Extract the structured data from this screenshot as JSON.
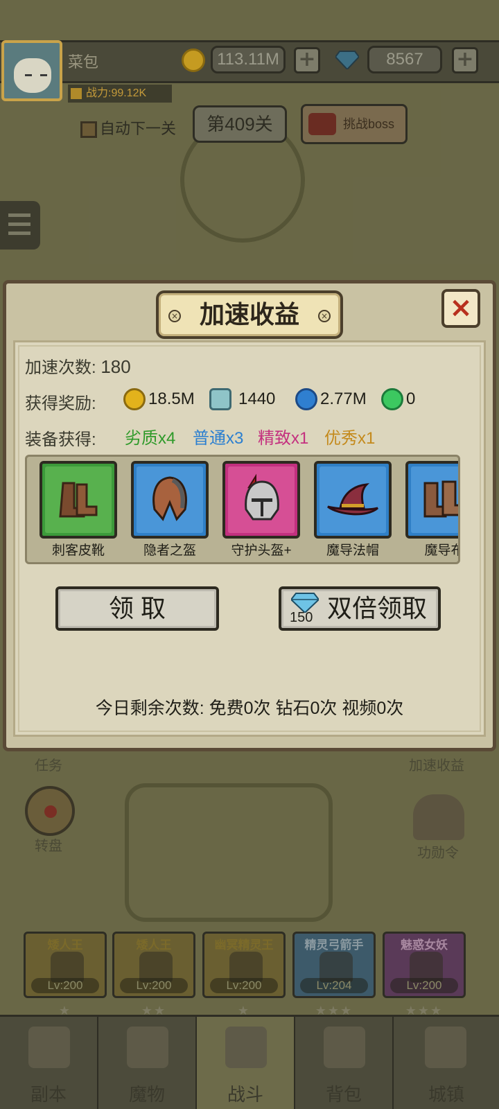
{
  "player": {
    "name": "菜包",
    "power": "战力:99.12K"
  },
  "resources": {
    "gold": "113.11M",
    "diamonds": "8567",
    "plus": "+"
  },
  "stage": {
    "auto_next_label": "自动下一关",
    "current_stage": "第409关",
    "boss_button": "挑战boss"
  },
  "background_labels": {
    "task": "任务",
    "speedup": "加速收益",
    "wheel": "转盘",
    "merit": "功勋令"
  },
  "heroes": [
    {
      "name": "矮人王",
      "level": "Lv:200",
      "stars": "★"
    },
    {
      "name": "矮人王",
      "level": "Lv:200",
      "stars": "★★"
    },
    {
      "name": "幽冥精灵王",
      "level": "Lv:200",
      "stars": "★"
    },
    {
      "name": "精灵弓箭手",
      "level": "Lv:204",
      "stars": "★★★"
    },
    {
      "name": "魅惑女妖",
      "level": "Lv:200",
      "stars": "★★★"
    }
  ],
  "bottom_nav": [
    {
      "label": "副本"
    },
    {
      "label": "魔物"
    },
    {
      "label": "战斗"
    },
    {
      "label": "背包"
    },
    {
      "label": "城镇"
    }
  ],
  "modal": {
    "title": "加速收益",
    "close": "×",
    "speedup_count_label": "加速次数:",
    "speedup_count_value": "180",
    "rewards_label": "获得奖励:",
    "rewards": [
      {
        "icon": "gold-coin-icon",
        "value": "18.5M"
      },
      {
        "icon": "crystal-ore-icon",
        "value": "1440"
      },
      {
        "icon": "blue-swirl-icon",
        "value": "2.77M"
      },
      {
        "icon": "green-gem-icon",
        "value": "0"
      }
    ],
    "equipment_label": "装备获得:",
    "grades": [
      {
        "text": "劣质x4",
        "color": "#2f9a2a"
      },
      {
        "text": "普通x3",
        "color": "#2b7fd0"
      },
      {
        "text": "精致x1",
        "color": "#c4307f"
      },
      {
        "text": "优秀x1",
        "color": "#c48a1c"
      }
    ],
    "items": [
      {
        "name": "刺客皮靴",
        "icon": "boots-icon",
        "frame_color": "#3c9a3a"
      },
      {
        "name": "隐者之盔",
        "icon": "helmet-icon",
        "frame_color": "#2f7fc6"
      },
      {
        "name": "守护头盔+",
        "icon": "knight-helmet-icon",
        "frame_color": "#c2307f"
      },
      {
        "name": "魔导法帽",
        "icon": "wizard-hat-icon",
        "frame_color": "#2f7fc6"
      },
      {
        "name": "魔导布",
        "icon": "cloth-boots-icon",
        "frame_color": "#2f7fc6"
      }
    ],
    "claim_button": "领 取",
    "double_claim_button": "双倍领取",
    "double_claim_cost": "150",
    "remaining_today": "今日剩余次数: 免费0次 钻石0次 视频0次"
  }
}
